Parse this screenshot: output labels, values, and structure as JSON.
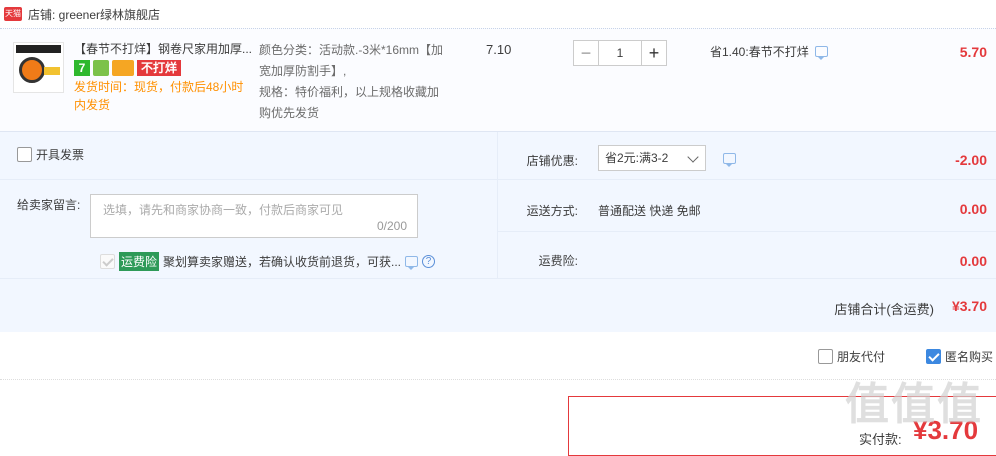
{
  "shop": {
    "badge": "天猫",
    "label": "店铺: greener绿林旗舰店"
  },
  "item": {
    "title": "【春节不打烊】钢卷尺家用加厚...",
    "badge_7": "7",
    "badge_no_close": "不打烊",
    "ship_time": "发货时间：现货，付款后48小时内发货",
    "sku_color": "颜色分类：活动款.-3米*16mm【加宽加厚防割手】,",
    "sku_spec": "规格：特价福利，以上规格收藏加购优先发货",
    "unit_price": "7.10",
    "quantity": "1",
    "qty_minus": "−",
    "qty_plus": "+",
    "promo": "省1.40:春节不打烊",
    "subtotal": "5.70"
  },
  "extras": {
    "invoice_label": "开具发票",
    "message_label": "给卖家留言:",
    "message_placeholder": "选填，请先和商家协商一致，付款后商家可见",
    "message_counter": "0/200",
    "coupon_label": "店铺优惠:",
    "coupon_value": "省2元:满3-2",
    "coupon_amount": "-2.00",
    "shipping_label": "运送方式:",
    "shipping_value": "普通配送 快递 免邮",
    "shipping_amount": "0.00",
    "insurance_label": "运费险:",
    "insurance_tag": "运费险",
    "insurance_text": "聚划算卖家赠送，若确认收货前退货，可获...",
    "insurance_amount": "0.00"
  },
  "shop_total": {
    "label": "店铺合计(含运费)",
    "amount": "¥3.70"
  },
  "pay_options": {
    "friend_pay": "朋友代付",
    "anonymous": "匿名购买"
  },
  "final": {
    "label": "实付款:",
    "amount": "¥3.70"
  },
  "watermark": {
    "text": "值值值"
  },
  "colors": {
    "accent": "#e4393c",
    "panel": "#f2f7ff",
    "checkbox": "#3c88e0"
  }
}
